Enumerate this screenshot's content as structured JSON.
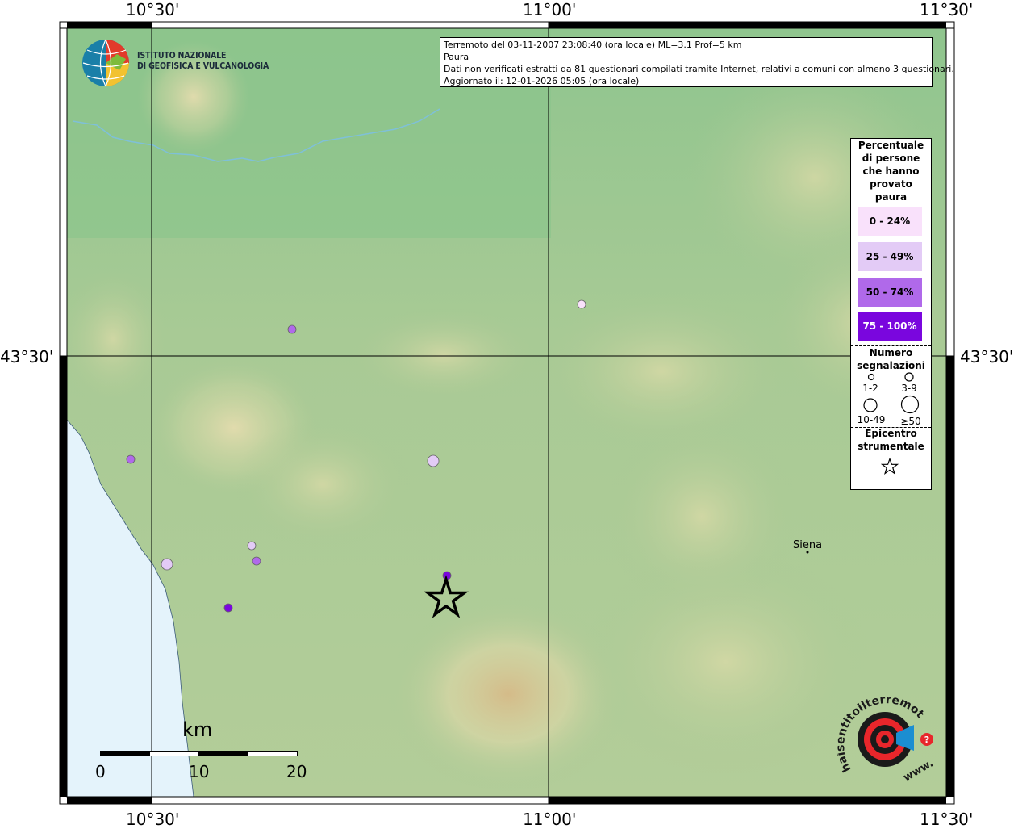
{
  "header": {
    "lines": [
      "Terremoto del 03-11-2007 23:08:40 (ora locale) ML=3.1 Prof=5 km",
      "Paura",
      "Dati non verificati estratti da 81 questionari compilati tramite Internet, relativi a comuni con almeno 3 questionari.",
      "Aggiornato il: 12-01-2026 05:05 (ora locale)"
    ]
  },
  "logo": {
    "line1": "ISTITUTO NAZIONALE",
    "line2": "DI GEOFISICA E VULCANOLOGIA"
  },
  "coords": {
    "top": [
      "10°30'",
      "11°00'",
      "11°30'"
    ],
    "bottom": [
      "10°30'",
      "11°00'",
      "11°30'"
    ],
    "left": "43°30'",
    "right": "43°30'"
  },
  "legend": {
    "title_lines": [
      "Percentuale",
      "di persone",
      "che hanno",
      "provato",
      "paura"
    ],
    "classes": [
      {
        "label": "0 - 24%",
        "color": "#f9e1fb",
        "text_color": "#000000"
      },
      {
        "label": "25 - 49%",
        "color": "#e3cbf6",
        "text_color": "#000000"
      },
      {
        "label": "50 - 74%",
        "color": "#b069ea",
        "text_color": "#000000"
      },
      {
        "label": "75 - 100%",
        "color": "#7a06de",
        "text_color": "#ffffff"
      }
    ],
    "size_title_lines": [
      "Numero",
      "segnalazioni"
    ],
    "sizes": [
      "1-2",
      "3-9",
      "10-49",
      "≥50"
    ],
    "epicenter_title_lines": [
      "Epicentro",
      "strumentale"
    ]
  },
  "places": [
    {
      "name": "Siena"
    }
  ],
  "scale": {
    "unit": "km",
    "ticks": [
      "0",
      "10",
      "20"
    ]
  },
  "points": [
    {
      "class": 0,
      "size": "3-9"
    },
    {
      "class": 2,
      "size": "3-9"
    },
    {
      "class": 2,
      "size": "3-9"
    },
    {
      "class": 1,
      "size": "10-49"
    },
    {
      "class": 1,
      "size": "3-9"
    },
    {
      "class": 2,
      "size": "3-9"
    },
    {
      "class": 1,
      "size": "10-49"
    },
    {
      "class": 3,
      "size": "3-9"
    },
    {
      "class": 3,
      "size": "3-9"
    }
  ],
  "website_logo": {
    "text": "haisentitoilterremoto.it",
    "url_text": "www."
  }
}
